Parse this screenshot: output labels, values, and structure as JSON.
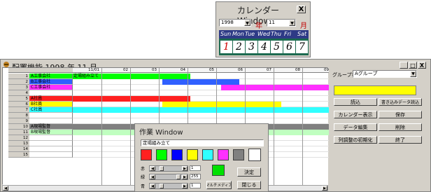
{
  "calendar": {
    "title": "カレンダーWindow",
    "close_label": "X",
    "year_value": "1998",
    "year_unit": "年",
    "month_value": "11",
    "month_unit": "月",
    "weekdays": [
      "Sun",
      "Mon",
      "Tue",
      "Wed",
      "Thu",
      "Fri",
      "Sat"
    ],
    "days": [
      "1",
      "2",
      "3",
      "4",
      "5",
      "6",
      "7"
    ]
  },
  "main": {
    "title": "配置機能  1998 年 11 月",
    "controls": [
      "_",
      "□",
      "X"
    ],
    "day_headers": [
      "11/01",
      "02",
      "03",
      "04",
      "05",
      "06",
      "07",
      "08",
      "09"
    ],
    "rows": [
      {
        "num": "1",
        "name": "A工事会社",
        "bg": "#00ff00"
      },
      {
        "num": "2",
        "name": "B工事会社",
        "bg": "#3060ff"
      },
      {
        "num": "3",
        "name": "C工事会社",
        "bg": "#ff30ff"
      },
      {
        "num": "4",
        "name": "",
        "bg": ""
      },
      {
        "num": "5",
        "name": "A社員",
        "bg": "#ff2020"
      },
      {
        "num": "6",
        "name": "B社員",
        "bg": "#ffff00"
      },
      {
        "num": "7",
        "name": "C社員",
        "bg": "#30ffff"
      },
      {
        "num": "8",
        "name": "",
        "bg": ""
      },
      {
        "num": "9",
        "name": "",
        "bg": ""
      },
      {
        "num": "10",
        "name": "A現場監督",
        "bg": "#808080"
      },
      {
        "num": "11",
        "name": "B現場監督",
        "bg": "#c0ffc0"
      },
      {
        "num": "12",
        "name": "",
        "bg": ""
      },
      {
        "num": "13",
        "name": "",
        "bg": ""
      },
      {
        "num": "14",
        "name": "",
        "bg": ""
      },
      {
        "num": "15",
        "name": "",
        "bg": ""
      }
    ],
    "cell_text": "定場組み立て",
    "bar_colors": {
      "green": "#00ff00",
      "blue": "#3060ff",
      "magenta": "#ff30ff",
      "red": "#ff2020",
      "yellow": "#ffff00",
      "cyan": "#30ffff",
      "gray": "#808080",
      "lightgreen": "#c0ffc0"
    }
  },
  "right_panel": {
    "group_label": "グループ名",
    "group_value": "Aグループ",
    "buttons": [
      "読込",
      "書き込みデータ読込",
      "カレンダー表示",
      "保存",
      "データ編集",
      "削除",
      "列調整の初期化",
      "終了"
    ]
  },
  "work_window": {
    "title": "作業 Window",
    "text_value": "定場組み立て",
    "colors": [
      "#ff2020",
      "#00ff00",
      "#0000ff",
      "#ffff00",
      "#30ffff",
      "#ff30ff",
      "#808080",
      "#ffffff"
    ],
    "slider_labels": [
      "赤",
      "緑",
      "青"
    ],
    "slider_values": [
      "1",
      "255",
      "1"
    ],
    "preview_color": "#00e000",
    "ok_button": "決定",
    "multi_button": "マルチメディア",
    "close_button": "閉じる"
  }
}
